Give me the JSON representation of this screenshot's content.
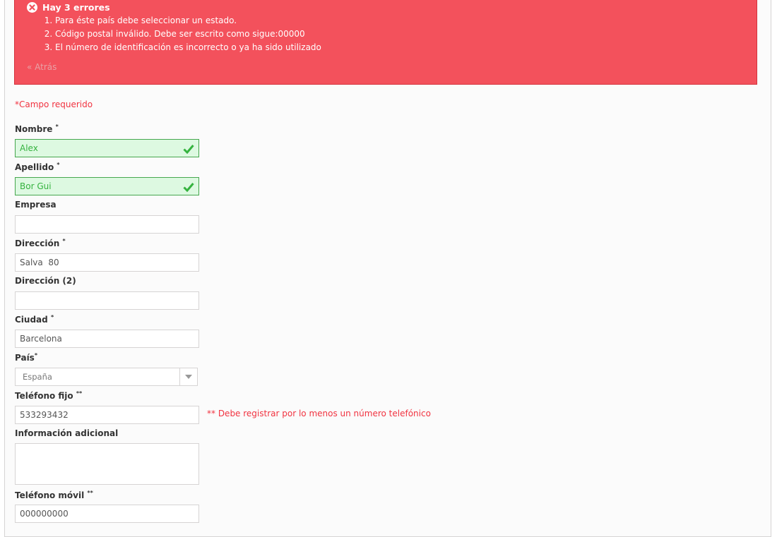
{
  "alert": {
    "title": "Hay 3 errores",
    "errors": [
      "Para éste país debe seleccionar un estado.",
      "Código postal inválido. Debe ser escrito como sigue:00000",
      "El número de identificación es incorrecto o ya ha sido utilizado"
    ],
    "back_link": "« Atrás"
  },
  "form": {
    "required_note": "*Campo requerido",
    "firstname": {
      "label": "Nombre",
      "mark": "*",
      "value": "Alex"
    },
    "lastname": {
      "label": "Apellido",
      "mark": "*",
      "value": "Bor Gui"
    },
    "company": {
      "label": "Empresa",
      "value": ""
    },
    "address1": {
      "label": "Dirección",
      "mark": "*",
      "value": "Salva  80"
    },
    "address2": {
      "label": "Dirección (2)",
      "value": ""
    },
    "city": {
      "label": "Ciudad",
      "mark": "*",
      "value": "Barcelona"
    },
    "country": {
      "label": "País",
      "mark": "*",
      "value": "España"
    },
    "phone": {
      "label": "Teléfono fijo",
      "mark": "**",
      "value": "533293432"
    },
    "phone_note": "** Debe registrar por lo menos un número telefónico",
    "other": {
      "label": "Información adicional",
      "value": ""
    },
    "mobile": {
      "label": "Teléfono móvil",
      "mark": "**",
      "value": "000000000"
    }
  },
  "colors": {
    "error_bg": "#f3515c",
    "valid_bg": "#ddf9e1",
    "valid_text": "#35b33f",
    "required": "#f13340"
  },
  "icons": {
    "alert": "close-circle-icon",
    "valid": "checkmark-icon",
    "select": "chevron-down-icon"
  }
}
